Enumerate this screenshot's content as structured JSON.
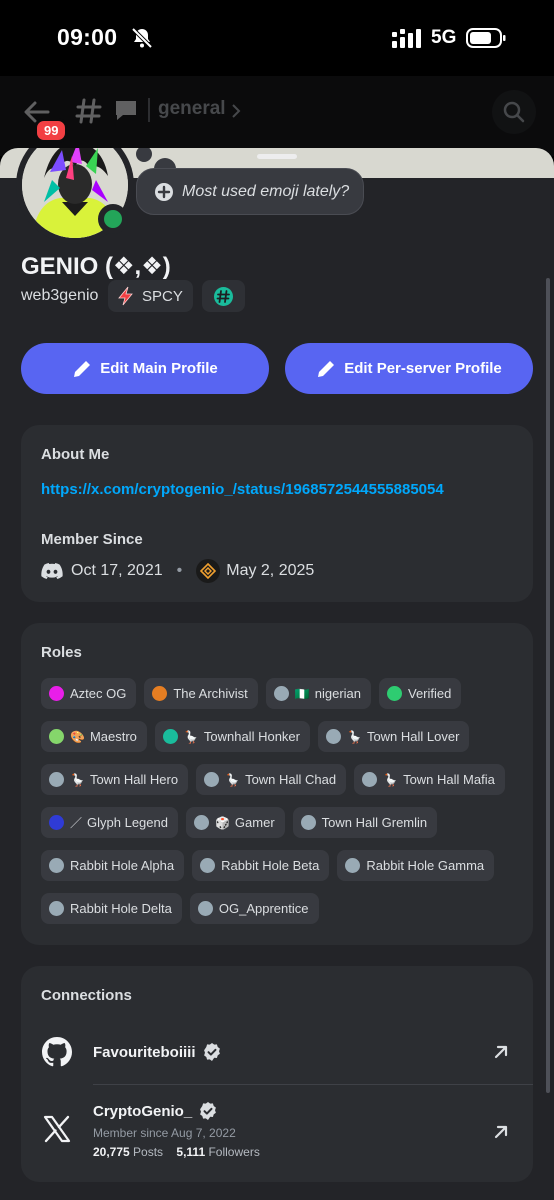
{
  "status_bar": {
    "time": "09:00",
    "network": "5G"
  },
  "channel_header": {
    "unread_count": "99",
    "channel_name": "general"
  },
  "profile": {
    "status_prompt": "Most used emoji lately?",
    "display_name": "GENIO (❖,❖)",
    "username": "web3genio",
    "tag": "SPCY"
  },
  "actions": {
    "edit_main": "Edit Main Profile",
    "edit_server": "Edit Per-server Profile"
  },
  "about": {
    "title": "About Me",
    "link": "https://x.com/cryptogenio_/status/1968572544555885054",
    "member_since_title": "Member Since",
    "discord_date": "Oct 17, 2021",
    "separator": "•",
    "server_date": "May 2, 2025"
  },
  "roles": {
    "title": "Roles",
    "items": [
      {
        "label": "Aztec OG",
        "color": "#e91ee9",
        "emoji": ""
      },
      {
        "label": "The Archivist",
        "color": "#e67e22",
        "emoji": ""
      },
      {
        "label": "nigerian",
        "color": "#99aab5",
        "emoji": "🇳🇬"
      },
      {
        "label": "Verified",
        "color": "#2ecc71",
        "emoji": ""
      },
      {
        "label": "Maestro",
        "color": "#85d66b",
        "emoji": "🎨"
      },
      {
        "label": "Townhall Honker",
        "color": "#1abc9c",
        "emoji": "🪿"
      },
      {
        "label": "Town Hall Lover",
        "color": "#99aab5",
        "emoji": "🪿"
      },
      {
        "label": "Town Hall Hero",
        "color": "#99aab5",
        "emoji": "🪿"
      },
      {
        "label": "Town Hall Chad",
        "color": "#99aab5",
        "emoji": "🪿"
      },
      {
        "label": "Town Hall Mafia",
        "color": "#99aab5",
        "emoji": "🪿"
      },
      {
        "label": "Glyph Legend",
        "color": "#2f3bd6",
        "emoji": "／"
      },
      {
        "label": "Gamer",
        "color": "#99aab5",
        "emoji": "🎲"
      },
      {
        "label": "Town Hall Gremlin",
        "color": "#99aab5",
        "emoji": ""
      },
      {
        "label": "Rabbit Hole Alpha",
        "color": "#99aab5",
        "emoji": ""
      },
      {
        "label": "Rabbit Hole Beta",
        "color": "#99aab5",
        "emoji": ""
      },
      {
        "label": "Rabbit Hole Gamma",
        "color": "#99aab5",
        "emoji": ""
      },
      {
        "label": "Rabbit Hole Delta",
        "color": "#99aab5",
        "emoji": ""
      },
      {
        "label": "OG_Apprentice",
        "color": "#99aab5",
        "emoji": ""
      }
    ]
  },
  "connections": {
    "title": "Connections",
    "github": {
      "name": "Favouriteboiiii"
    },
    "x": {
      "name": "CryptoGenio_",
      "member_since": "Member since Aug 7, 2022",
      "posts_count": "20,775",
      "posts_label": "Posts",
      "followers_count": "5,111",
      "followers_label": "Followers"
    }
  }
}
